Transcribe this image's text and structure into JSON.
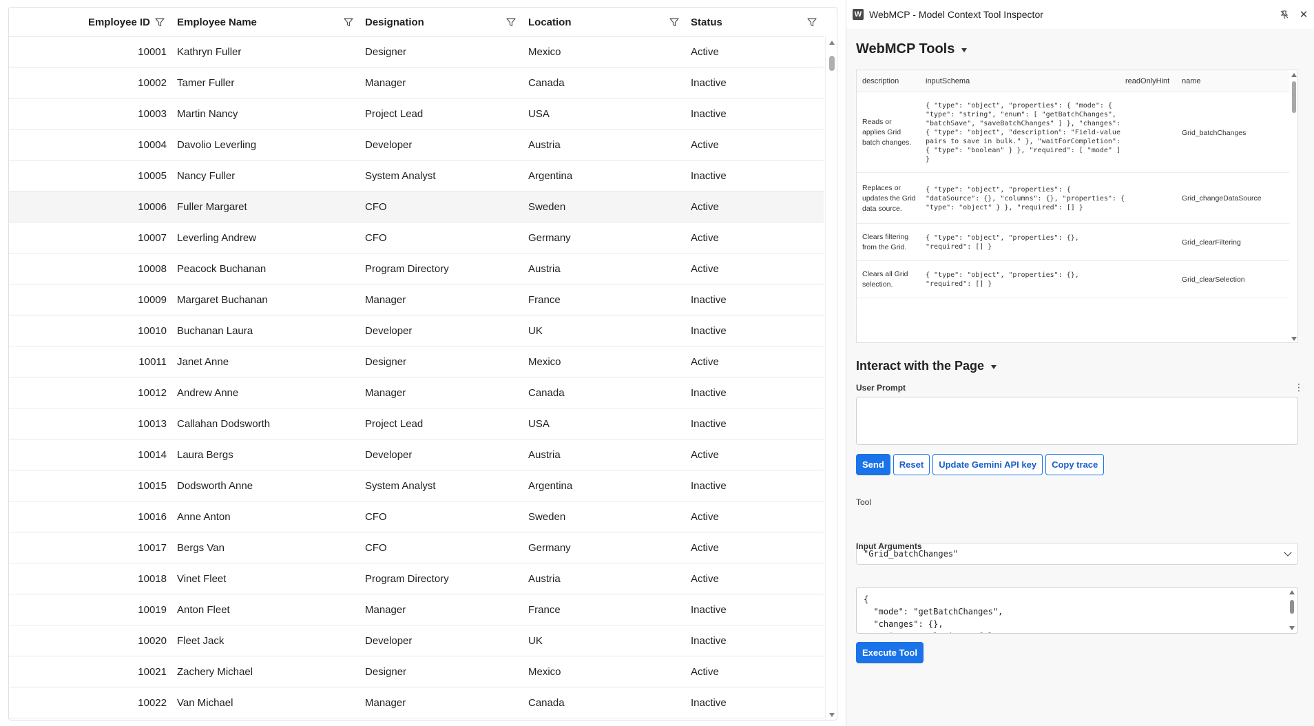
{
  "grid": {
    "columns": [
      {
        "label": "Employee ID"
      },
      {
        "label": "Employee Name"
      },
      {
        "label": "Designation"
      },
      {
        "label": "Location"
      },
      {
        "label": "Status"
      }
    ],
    "rows": [
      {
        "id": "10001",
        "name": "Kathryn Fuller",
        "designation": "Designer",
        "location": "Mexico",
        "status": "Active"
      },
      {
        "id": "10002",
        "name": "Tamer Fuller",
        "designation": "Manager",
        "location": "Canada",
        "status": "Inactive"
      },
      {
        "id": "10003",
        "name": "Martin Nancy",
        "designation": "Project Lead",
        "location": "USA",
        "status": "Inactive"
      },
      {
        "id": "10004",
        "name": "Davolio Leverling",
        "designation": "Developer",
        "location": "Austria",
        "status": "Active"
      },
      {
        "id": "10005",
        "name": "Nancy Fuller",
        "designation": "System Analyst",
        "location": "Argentina",
        "status": "Inactive"
      },
      {
        "id": "10006",
        "name": "Fuller Margaret",
        "designation": "CFO",
        "location": "Sweden",
        "status": "Active"
      },
      {
        "id": "10007",
        "name": "Leverling Andrew",
        "designation": "CFO",
        "location": "Germany",
        "status": "Active"
      },
      {
        "id": "10008",
        "name": "Peacock Buchanan",
        "designation": "Program Directory",
        "location": "Austria",
        "status": "Active"
      },
      {
        "id": "10009",
        "name": "Margaret Buchanan",
        "designation": "Manager",
        "location": "France",
        "status": "Inactive"
      },
      {
        "id": "10010",
        "name": "Buchanan Laura",
        "designation": "Developer",
        "location": "UK",
        "status": "Inactive"
      },
      {
        "id": "10011",
        "name": "Janet Anne",
        "designation": "Designer",
        "location": "Mexico",
        "status": "Active"
      },
      {
        "id": "10012",
        "name": "Andrew Anne",
        "designation": "Manager",
        "location": "Canada",
        "status": "Inactive"
      },
      {
        "id": "10013",
        "name": "Callahan Dodsworth",
        "designation": "Project Lead",
        "location": "USA",
        "status": "Inactive"
      },
      {
        "id": "10014",
        "name": "Laura Bergs",
        "designation": "Developer",
        "location": "Austria",
        "status": "Active"
      },
      {
        "id": "10015",
        "name": "Dodsworth Anne",
        "designation": "System Analyst",
        "location": "Argentina",
        "status": "Inactive"
      },
      {
        "id": "10016",
        "name": "Anne Anton",
        "designation": "CFO",
        "location": "Sweden",
        "status": "Active"
      },
      {
        "id": "10017",
        "name": "Bergs Van",
        "designation": "CFO",
        "location": "Germany",
        "status": "Active"
      },
      {
        "id": "10018",
        "name": "Vinet Fleet",
        "designation": "Program Directory",
        "location": "Austria",
        "status": "Active"
      },
      {
        "id": "10019",
        "name": "Anton Fleet",
        "designation": "Manager",
        "location": "France",
        "status": "Inactive"
      },
      {
        "id": "10020",
        "name": "Fleet Jack",
        "designation": "Developer",
        "location": "UK",
        "status": "Inactive"
      },
      {
        "id": "10021",
        "name": "Zachery Michael",
        "designation": "Designer",
        "location": "Mexico",
        "status": "Active"
      },
      {
        "id": "10022",
        "name": "Van Michael",
        "designation": "Manager",
        "location": "Canada",
        "status": "Inactive"
      }
    ],
    "highlighted_row": "10006",
    "filter_icon": "funnel-icon"
  },
  "inspector": {
    "app_icon_letter": "W",
    "window_title": "WebMCP - Model Context Tool Inspector",
    "pin_icon": "unpin-icon",
    "close_icon": "close-icon",
    "tools_section": {
      "title": "WebMCP Tools",
      "headers": [
        "description",
        "inputSchema",
        "readOnlyHint",
        "name"
      ],
      "rows": [
        {
          "description": "Reads or applies Grid batch changes.",
          "input_schema": "{ \"type\": \"object\", \"properties\": { \"mode\": { \"type\": \"string\", \"enum\": [ \"getBatchChanges\", \"batchSave\", \"saveBatchChanges\" ] }, \"changes\": { \"type\": \"object\", \"description\": \"Field-value pairs to save in bulk.\" }, \"waitForCompletion\": { \"type\": \"boolean\" } }, \"required\": [ \"mode\" ] }",
          "read_only_hint": "",
          "name": "Grid_batchChanges"
        },
        {
          "description": "Replaces or updates the Grid data source.",
          "input_schema": "{ \"type\": \"object\", \"properties\": { \"dataSource\": {}, \"columns\": {}, \"properties\": { \"type\": \"object\" } }, \"required\": [] }",
          "read_only_hint": "",
          "name": "Grid_changeDataSource"
        },
        {
          "description": "Clears filtering from the Grid.",
          "input_schema": "{ \"type\": \"object\", \"properties\": {}, \"required\": [] }",
          "read_only_hint": "",
          "name": "Grid_clearFiltering"
        },
        {
          "description": "Clears all Grid selection.",
          "input_schema": "{ \"type\": \"object\", \"properties\": {}, \"required\": [] }",
          "read_only_hint": "",
          "name": "Grid_clearSelection"
        }
      ]
    },
    "interact_section": {
      "title": "Interact with the Page",
      "user_prompt_label": "User Prompt",
      "user_prompt_value": "",
      "buttons": {
        "send": "Send",
        "reset": "Reset",
        "update_key": "Update Gemini API key",
        "copy_trace": "Copy trace"
      },
      "tool_label": "Tool",
      "tool_selected": "\"Grid_batchChanges\"",
      "input_args_label": "Input Arguments",
      "input_args_value": "{\n  \"mode\": \"getBatchChanges\",\n  \"changes\": {},\n  \"waitForCompletion\": false\n}",
      "execute_label": "Execute Tool"
    }
  },
  "colors": {
    "accent": "#1a73e8",
    "row_highlight": "#f5f5f5"
  }
}
